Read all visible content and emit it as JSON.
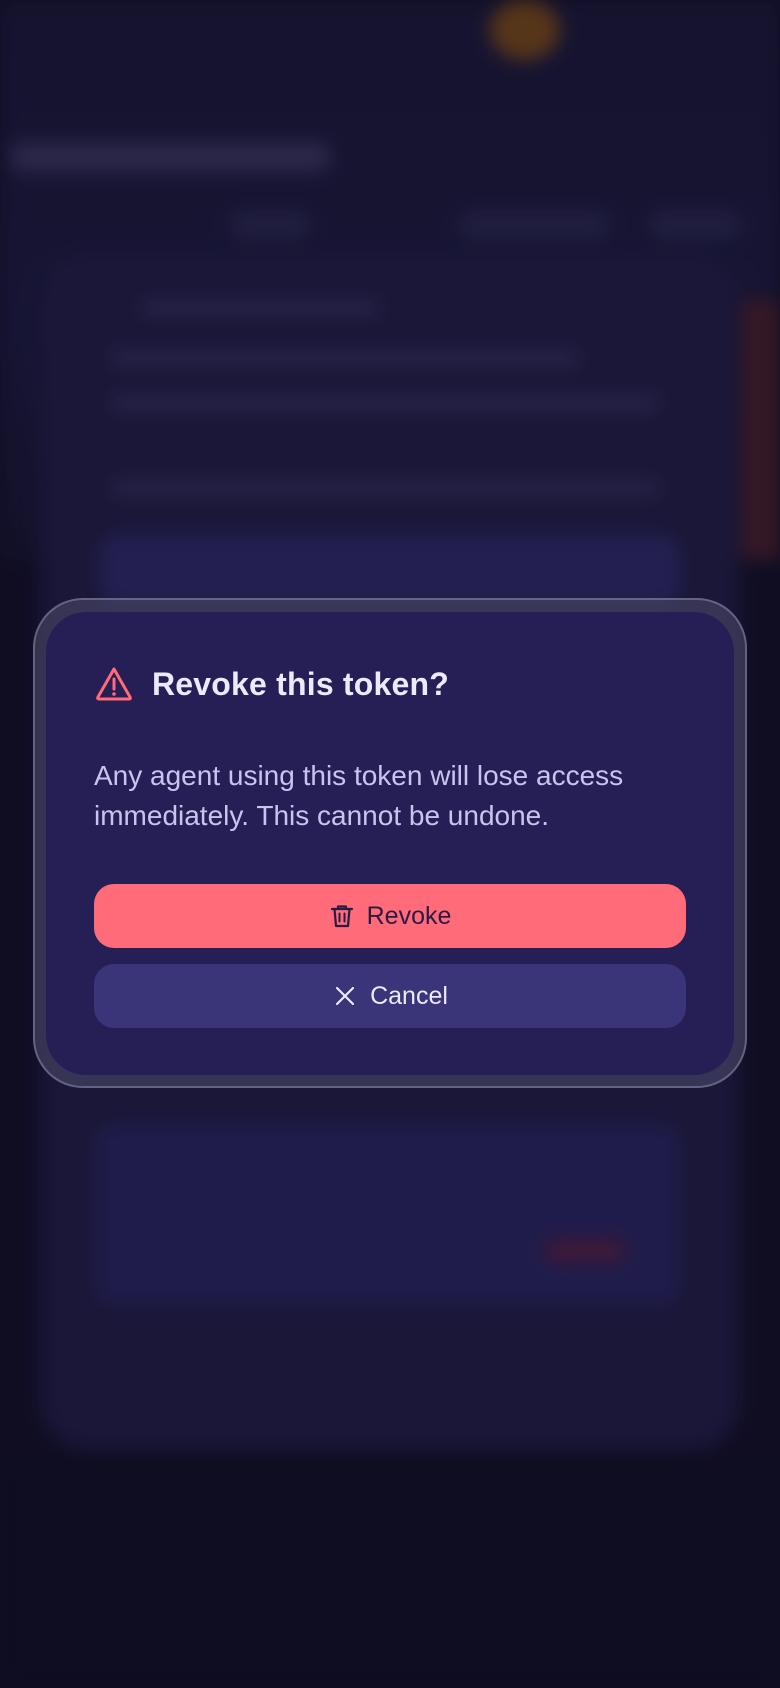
{
  "dialog": {
    "title": "Revoke this token?",
    "message": "Any agent using this token will lose access immediately. This cannot be undone.",
    "confirm_label": "Revoke",
    "cancel_label": "Cancel",
    "icons": {
      "header": "warning-triangle-icon",
      "confirm": "trash-icon",
      "cancel": "close-icon"
    }
  },
  "colors": {
    "danger": "#ff6b79",
    "dialog_bg": "#261f55",
    "cancel_bg": "#3a3478",
    "page_bg": "#120f26"
  }
}
